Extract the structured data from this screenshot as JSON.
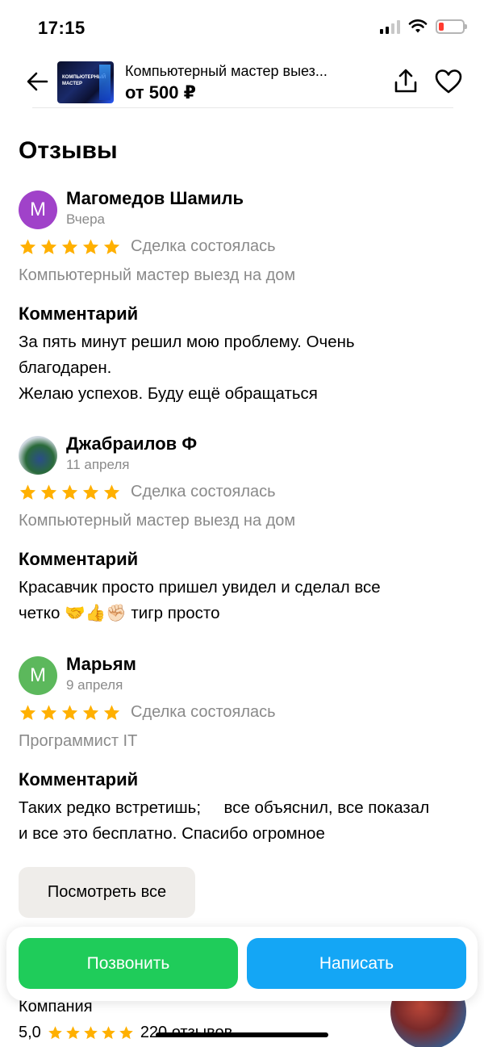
{
  "status": {
    "time": "17:15"
  },
  "header": {
    "thumb_text": "КОМПЬЮТЕРНЫЙ МАСТЕР",
    "title": "Компьютерный мастер выез...",
    "price": "от 500 ₽"
  },
  "section_title": "Отзывы",
  "reviews": [
    {
      "avatar_letter": "М",
      "avatar_color": "#a042c9",
      "author": "Магомедов Шамиль",
      "date": "Вчера",
      "rating": 5,
      "deal": "Сделка состоялась",
      "service": "Компьютерный мастер выезд на дом",
      "comment_label": "Комментарий",
      "comment_lines": [
        "За пять минут решил мою проблему. Очень",
        "благодарен.",
        "Желаю успехов. Буду ещё обращаться"
      ]
    },
    {
      "avatar_letter": "",
      "author": "Джабраилов Ф",
      "date": "11 апреля",
      "rating": 5,
      "deal": "Сделка состоялась",
      "service": "Компьютерный мастер выезд на дом",
      "comment_label": "Комментарий",
      "comment_lines": [
        "Красавчик просто пришел увидел и сделал все",
        "четко 🤝👍✊🏻 тигр просто"
      ]
    },
    {
      "avatar_letter": "М",
      "avatar_color": "#5cb85c",
      "author": "Марьям",
      "date": "9 апреля",
      "rating": 5,
      "deal": "Сделка состоялась",
      "service": "Программист IT",
      "comment_label": "Комментарий",
      "comment_lines": [
        "Таких редко встретишь;     все объяснил, все показал",
        "и все это бесплатно. Спасибо огромное"
      ]
    }
  ],
  "view_all_label": "Посмотреть все",
  "company": {
    "label": "Компания",
    "rating": "5,0",
    "reviews_count": "220 отзывов"
  },
  "actions": {
    "call_label": "Позвонить",
    "write_label": "Написать"
  },
  "colors": {
    "star": "#ffb000",
    "call": "#1fcc5a",
    "write": "#14a6f5",
    "muted_text": "#8a8a8a"
  },
  "icons": [
    "back-arrow-icon",
    "share-icon",
    "heart-icon",
    "star-icon",
    "signal-icon",
    "wifi-icon",
    "battery-icon"
  ]
}
